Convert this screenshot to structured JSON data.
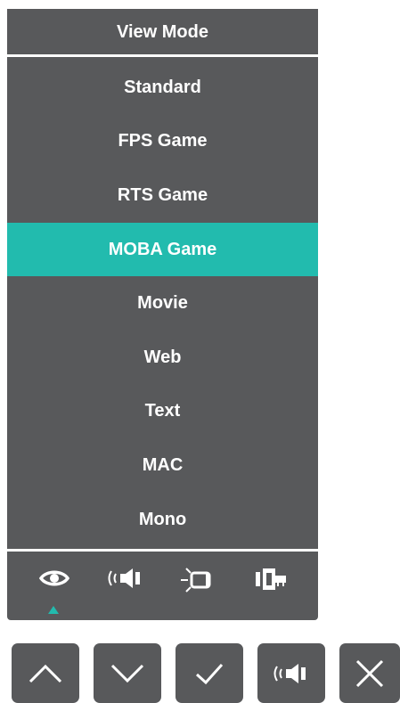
{
  "osd": {
    "title": "View Mode",
    "items": [
      {
        "label": "Standard",
        "selected": false
      },
      {
        "label": "FPS Game",
        "selected": false
      },
      {
        "label": "RTS Game",
        "selected": false
      },
      {
        "label": "MOBA Game",
        "selected": true
      },
      {
        "label": "Movie",
        "selected": false
      },
      {
        "label": "Web",
        "selected": false
      },
      {
        "label": "Text",
        "selected": false
      },
      {
        "label": "MAC",
        "selected": false
      },
      {
        "label": "Mono",
        "selected": false
      }
    ],
    "tabs": [
      {
        "icon": "eye-icon",
        "active": true
      },
      {
        "icon": "speaker-icon",
        "active": false
      },
      {
        "icon": "display-icon",
        "active": false
      },
      {
        "icon": "input-source-icon",
        "active": false
      }
    ]
  },
  "keys": [
    {
      "icon": "chevron-up-icon"
    },
    {
      "icon": "chevron-down-icon"
    },
    {
      "icon": "check-icon"
    },
    {
      "icon": "speaker-icon"
    },
    {
      "icon": "close-icon"
    }
  ],
  "colors": {
    "panel": "#58595b",
    "accent": "#22bbae",
    "text": "#ffffff"
  }
}
